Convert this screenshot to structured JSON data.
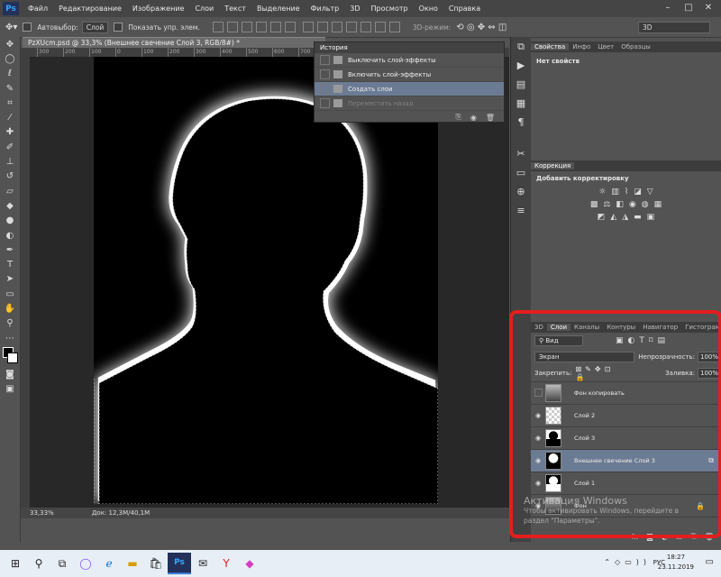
{
  "app": {
    "logo": "Ps"
  },
  "menu": [
    "Файл",
    "Редактирование",
    "Изображение",
    "Слои",
    "Текст",
    "Выделение",
    "Фильтр",
    "3D",
    "Просмотр",
    "Окно",
    "Справка"
  ],
  "options": {
    "autoselect_label": "Автовыбор:",
    "autoselect_value": "Слой",
    "show_controls_label": "Показать упр. элем.",
    "mode3d_label": "3D-режим:",
    "workspace": "3D"
  },
  "document": {
    "tab_title": "PzXUcm.psd @ 33,3% (Внешнее свечение Слой 3, RGB/8#) *",
    "ruler_marks": [
      "300",
      "200",
      "100",
      "0",
      "100",
      "200",
      "300",
      "400",
      "500",
      "600",
      "700",
      "800",
      "900",
      "1000",
      "1100",
      "1200",
      "1300",
      "1400"
    ],
    "zoom": "33,33%",
    "doc_info": "Док: 12,3M/40,1M"
  },
  "history": {
    "title": "История",
    "items": [
      {
        "label": "Выключить слой-эффекты",
        "state": "normal"
      },
      {
        "label": "Включить слой-эффекты",
        "state": "normal"
      },
      {
        "label": "Создать слои",
        "state": "active"
      },
      {
        "label": "Переместить назад",
        "state": "dim"
      }
    ]
  },
  "properties": {
    "tabs": [
      "Свойства",
      "Инфо",
      "Цвет",
      "Образцы"
    ],
    "empty_text": "Нет свойств"
  },
  "adjustments": {
    "tab": "Коррекция",
    "subtitle": "Добавить корректировку"
  },
  "layers": {
    "tabs": [
      "3D",
      "Слои",
      "Каналы",
      "Контуры",
      "Навигатор",
      "Гистограмма"
    ],
    "filter": "Вид",
    "blend_mode": "Экран",
    "opacity_label": "Непрозрачность:",
    "opacity": "100%",
    "lock_label": "Закрепить:",
    "fill_label": "Заливка:",
    "fill": "100%",
    "rows": [
      {
        "name": "Фон копировать",
        "visible": false,
        "active": false,
        "thumb": "photo"
      },
      {
        "name": "Слой 2",
        "visible": true,
        "active": false,
        "thumb": "transparent"
      },
      {
        "name": "Слой 3",
        "visible": true,
        "active": false,
        "thumb": "silhouette-black"
      },
      {
        "name": "Внешнее свечение Слой 3",
        "visible": true,
        "active": true,
        "thumb": "silhouette-white"
      },
      {
        "name": "Слой 1",
        "visible": true,
        "active": false,
        "thumb": "silhouette-mask"
      },
      {
        "name": "Фон",
        "visible": true,
        "active": false,
        "thumb": "photo"
      }
    ]
  },
  "watermark": {
    "line1": "Активация Windows",
    "line2": "Чтобы активировать Windows, перейдите в",
    "line3": "раздел \"Параметры\"."
  },
  "taskbar": {
    "lang": "РУС",
    "time": "18:27",
    "date": "23.11.2019"
  },
  "colors": {
    "selection_highlight": "#6b7b93",
    "annotation_red": "#e41e1e",
    "canvas_bg": "#000000"
  }
}
